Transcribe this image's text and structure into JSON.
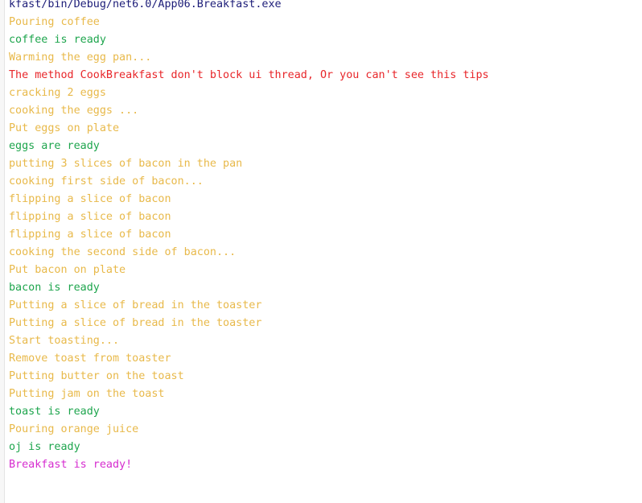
{
  "console": {
    "path": "kfast/bin/Debug/net6.0/App06.Breakfast.exe",
    "lines": [
      {
        "text": "Pouring coffee",
        "kind": "info"
      },
      {
        "text": "coffee is ready",
        "kind": "ready"
      },
      {
        "text": "Warming the egg pan...",
        "kind": "info"
      },
      {
        "text": "The method CookBreakfast don't block ui thread, Or you can't see this tips",
        "kind": "tip"
      },
      {
        "text": "cracking 2 eggs",
        "kind": "info"
      },
      {
        "text": "cooking the eggs ...",
        "kind": "info"
      },
      {
        "text": "Put eggs on plate",
        "kind": "info"
      },
      {
        "text": "eggs are ready",
        "kind": "ready"
      },
      {
        "text": "putting 3 slices of bacon in the pan",
        "kind": "info"
      },
      {
        "text": "cooking first side of bacon...",
        "kind": "info"
      },
      {
        "text": "flipping a slice of bacon",
        "kind": "info"
      },
      {
        "text": "flipping a slice of bacon",
        "kind": "info"
      },
      {
        "text": "flipping a slice of bacon",
        "kind": "info"
      },
      {
        "text": "cooking the second side of bacon...",
        "kind": "info"
      },
      {
        "text": "Put bacon on plate",
        "kind": "info"
      },
      {
        "text": "bacon is ready",
        "kind": "ready"
      },
      {
        "text": "Putting a slice of bread in the toaster",
        "kind": "info"
      },
      {
        "text": "Putting a slice of bread in the toaster",
        "kind": "info"
      },
      {
        "text": "Start toasting...",
        "kind": "info"
      },
      {
        "text": "Remove toast from toaster",
        "kind": "info"
      },
      {
        "text": "Putting butter on the toast",
        "kind": "info"
      },
      {
        "text": "Putting jam on the toast",
        "kind": "info"
      },
      {
        "text": "toast is ready",
        "kind": "ready"
      },
      {
        "text": "Pouring orange juice",
        "kind": "info"
      },
      {
        "text": "oj is ready",
        "kind": "ready"
      },
      {
        "text": "Breakfast is ready!",
        "kind": "done"
      }
    ]
  },
  "colors": {
    "path": "#1c1c78",
    "info": "#e8b94a",
    "ready": "#1ea54d",
    "tip": "#e8262a",
    "done": "#d62ccf"
  }
}
